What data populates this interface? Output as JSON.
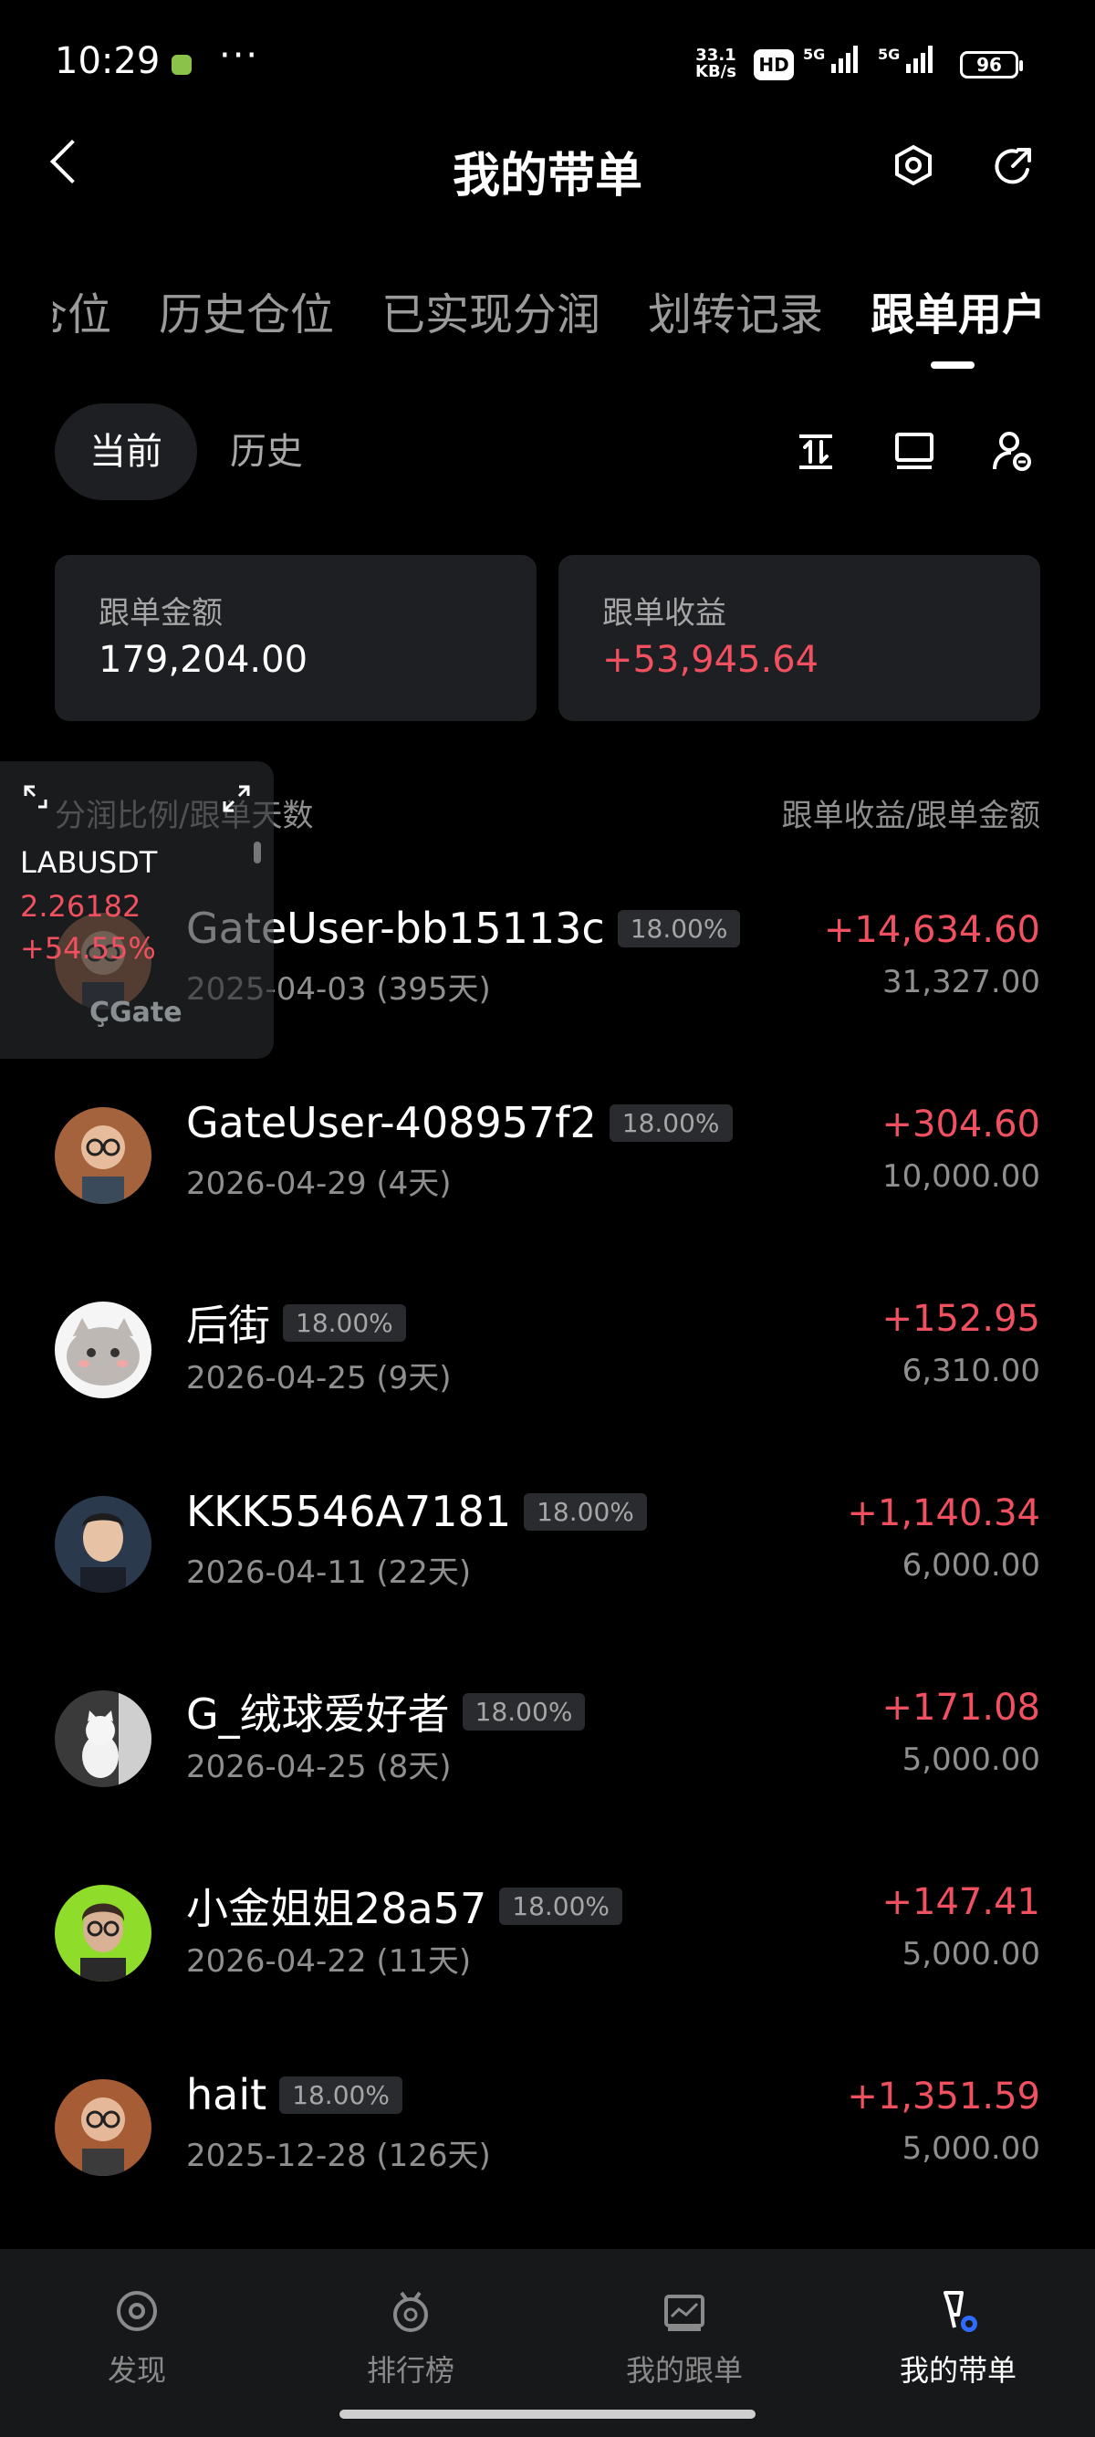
{
  "status_bar": {
    "time": "10:29",
    "net_speed_value": "33.1",
    "net_speed_unit": "KB/s",
    "hd_label": "HD",
    "signal1_label": "5G",
    "signal2_label": "5G",
    "battery": "96"
  },
  "header": {
    "title": "我的带单"
  },
  "tabs": [
    {
      "label": "仓位"
    },
    {
      "label": "历史仓位"
    },
    {
      "label": "已实现分润"
    },
    {
      "label": "划转记录"
    },
    {
      "label": "跟单用户"
    }
  ],
  "filter": {
    "current": "当前",
    "history": "历史"
  },
  "summary": {
    "amount_label": "跟单金额",
    "amount_value": "179,204.00",
    "profit_label": "跟单收益",
    "profit_value": "+53,945.64"
  },
  "list_header": {
    "left": "分润比例/跟单天数",
    "right": "跟单收益/跟单金额"
  },
  "followers": [
    {
      "name": "GateUser-bb15113c",
      "pct": "18.00%",
      "date": "2025-04-03 (395天)",
      "profit": "+14,634.60",
      "amount": "31,327.00",
      "avatar": "person-glasses-icon"
    },
    {
      "name": "GateUser-408957f2",
      "pct": "18.00%",
      "date": "2026-04-29 (4天)",
      "profit": "+304.60",
      "amount": "10,000.00",
      "avatar": "person-glasses-icon"
    },
    {
      "name": "后街",
      "pct": "18.00%",
      "date": "2026-04-25 (9天)",
      "profit": "+152.95",
      "amount": "6,310.00",
      "avatar": "cartoon-cat-icon"
    },
    {
      "name": "KKK5546A7181",
      "pct": "18.00%",
      "date": "2026-04-11 (22天)",
      "profit": "+1,140.34",
      "amount": "6,000.00",
      "avatar": "person-smiling-icon"
    },
    {
      "name": "G_绒球爱好者",
      "pct": "18.00%",
      "date": "2026-04-25 (8天)",
      "profit": "+171.08",
      "amount": "5,000.00",
      "avatar": "white-cat-icon"
    },
    {
      "name": "小金姐姐28a57",
      "pct": "18.00%",
      "date": "2026-04-22 (11天)",
      "profit": "+147.41",
      "amount": "5,000.00",
      "avatar": "person-green-bg-icon"
    },
    {
      "name": "hait",
      "pct": "18.00%",
      "date": "2025-12-28 (126天)",
      "profit": "+1,351.59",
      "amount": "5,000.00",
      "avatar": "person-glasses-icon"
    }
  ],
  "widget": {
    "symbol": "LABUSDT",
    "price": "2.26182",
    "change": "+54.55%",
    "logo": "Gate"
  },
  "bottom_nav": [
    {
      "label": "发现",
      "icon": "discover-icon"
    },
    {
      "label": "排行榜",
      "icon": "leaderboard-icon"
    },
    {
      "label": "我的跟单",
      "icon": "my-copy-icon"
    },
    {
      "label": "我的带单",
      "icon": "my-lead-icon"
    }
  ],
  "colors": {
    "background": "#000000",
    "card": "#1e1f22",
    "profit_red": "#f0505f",
    "muted": "#8f8f8f",
    "active_badge": "#2f6bff"
  }
}
